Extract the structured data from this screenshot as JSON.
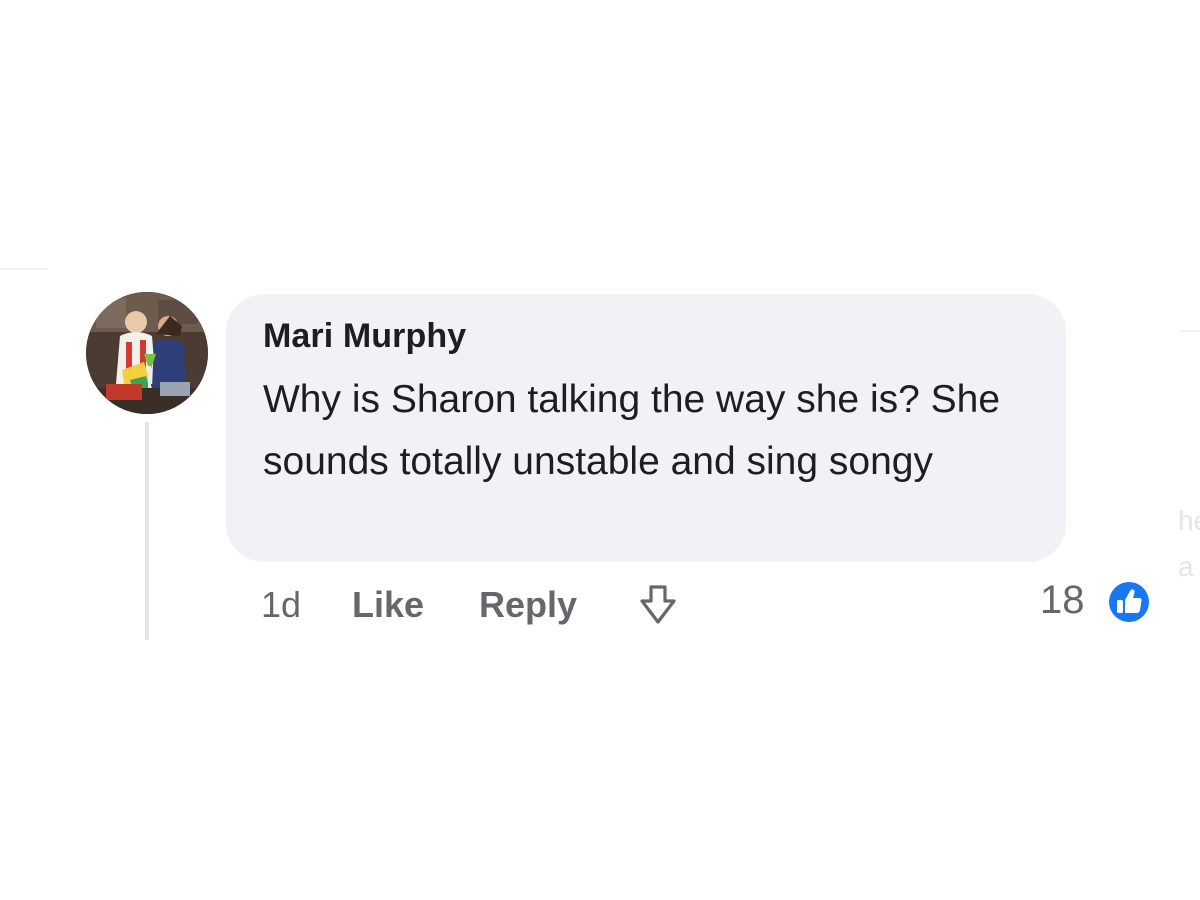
{
  "comment": {
    "author": "Mari Murphy",
    "text": "Why is Sharon talking the way she is? She sounds totally unstable and sing songy",
    "timestamp": "1d",
    "like_label": "Like",
    "reply_label": "Reply",
    "reaction_count": "18",
    "reaction_type": "like-reaction-icon",
    "share_icon": "share-arrow-icon",
    "avatar": "user-avatar-photo"
  },
  "edge_fragments": [
    "he",
    "a"
  ],
  "colors": {
    "bubble_background": "#f0f2f5",
    "text_primary": "#1c1e21",
    "text_secondary": "#65676b",
    "like_blue": "#1877f2",
    "thread_line": "#e4e6eb"
  }
}
